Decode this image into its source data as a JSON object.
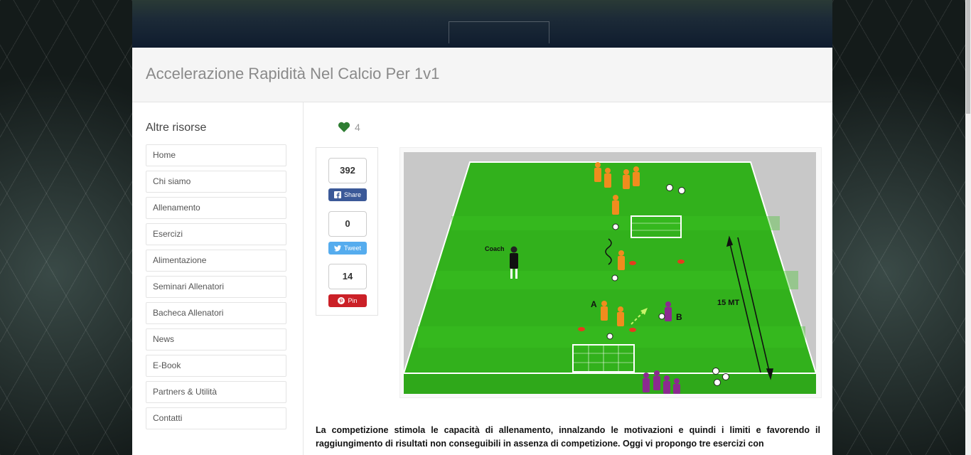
{
  "page": {
    "title": "Accelerazione Rapidità Nel Calcio Per 1v1"
  },
  "sidebar": {
    "heading": "Altre risorse",
    "items": [
      {
        "label": "Home"
      },
      {
        "label": "Chi siamo"
      },
      {
        "label": "Allenamento"
      },
      {
        "label": "Esercizi"
      },
      {
        "label": "Alimentazione"
      },
      {
        "label": "Seminari Allenatori"
      },
      {
        "label": "Bacheca Allenatori"
      },
      {
        "label": "News"
      },
      {
        "label": "E-Book"
      },
      {
        "label": "Partners & Utilità"
      },
      {
        "label": "Contatti"
      }
    ]
  },
  "likes": {
    "count": "4",
    "icon": "heart-icon",
    "color": "#2e7d32"
  },
  "share": {
    "facebook": {
      "count": "392",
      "label": "Share",
      "icon": "facebook-icon",
      "color": "#3b5998"
    },
    "twitter": {
      "count": "0",
      "label": "Tweet",
      "icon": "twitter-icon",
      "color": "#55acee"
    },
    "pinterest": {
      "count": "14",
      "label": "Pin",
      "icon": "pinterest-icon",
      "color": "#cb2027"
    }
  },
  "diagram": {
    "coach_label": "Coach",
    "label_a": "A",
    "label_b": "B",
    "distance_label": "15 MT"
  },
  "article": {
    "text": "La competizione stimola le capacità di allenamento, innalzando le motivazioni e quindi i limiti e favorendo il raggiungimento di  risultati non conseguibili in assenza di competizione. Oggi vi propongo tre esercizi con"
  }
}
